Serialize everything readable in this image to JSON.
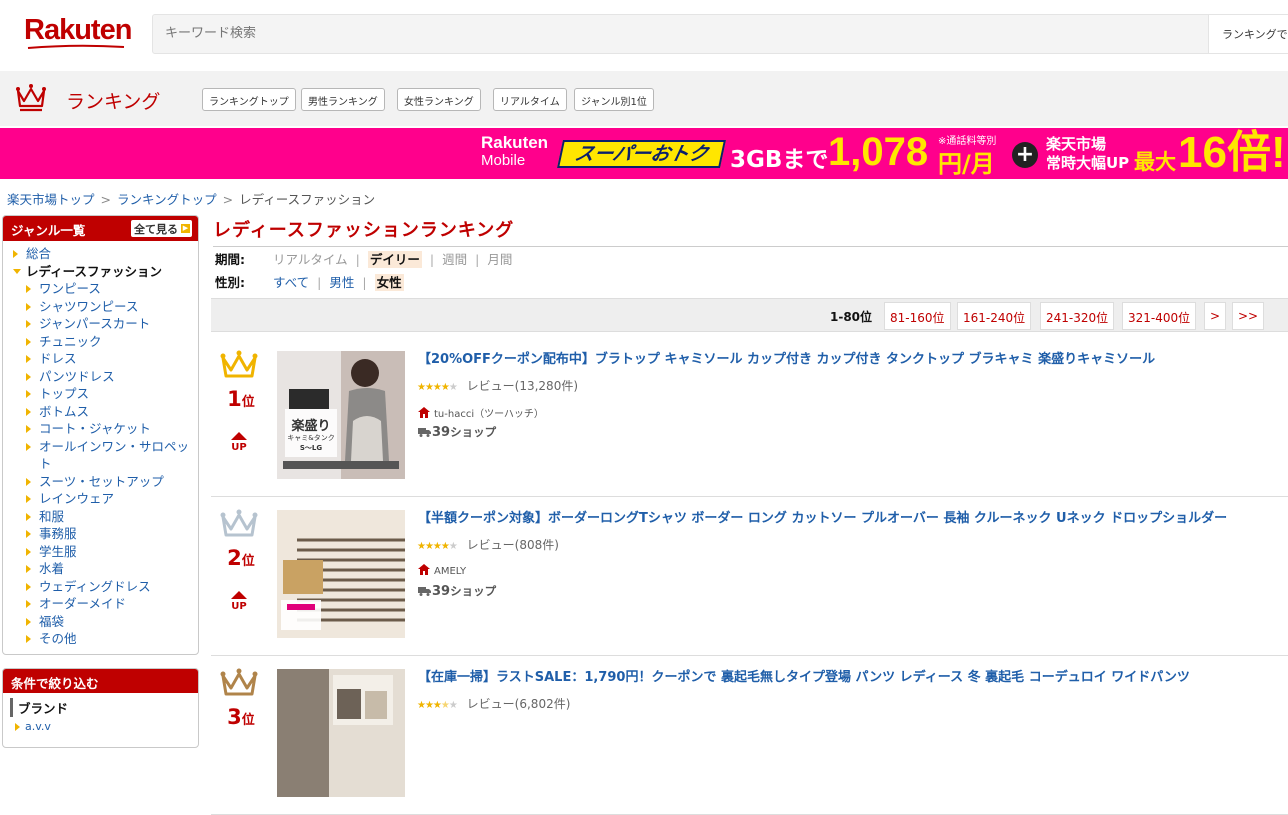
{
  "header": {
    "logo": "Rakuten",
    "search_placeholder": "キーワード検索",
    "search_scope": "ランキングで"
  },
  "ranking_nav": {
    "title": "ランキング",
    "buttons": [
      "ランキングトップ",
      "男性ランキング",
      "女性ランキング",
      "リアルタイム",
      "ジャンル別1位"
    ]
  },
  "banner": {
    "brand_top": "Rakuten",
    "brand_bottom": "Mobile",
    "super": "スーパーおトク",
    "gb": "3GBまで",
    "price": "1,078",
    "note": "※通話料等別",
    "unit": "円/月",
    "plus": "+",
    "market_line1": "楽天市場",
    "market_line2": "常時大幅UP",
    "max": "最大",
    "times": "16倍!"
  },
  "breadcrumb": [
    "楽天市場トップ",
    "ランキングトップ",
    "レディースファッション"
  ],
  "breadcrumb_sep": ">",
  "sidebar": {
    "head": "ジャンル一覧",
    "see_all": "全て見る",
    "items": [
      {
        "label": "総合",
        "level": 0,
        "current": false
      },
      {
        "label": "レディースファッション",
        "level": 0,
        "current": true
      },
      {
        "label": "ワンピース",
        "level": 1,
        "current": false
      },
      {
        "label": "シャツワンピース",
        "level": 1,
        "current": false
      },
      {
        "label": "ジャンパースカート",
        "level": 1,
        "current": false
      },
      {
        "label": "チュニック",
        "level": 1,
        "current": false
      },
      {
        "label": "ドレス",
        "level": 1,
        "current": false
      },
      {
        "label": "パンツドレス",
        "level": 1,
        "current": false
      },
      {
        "label": "トップス",
        "level": 1,
        "current": false
      },
      {
        "label": "ボトムス",
        "level": 1,
        "current": false
      },
      {
        "label": "コート・ジャケット",
        "level": 1,
        "current": false
      },
      {
        "label": "オールインワン・サロペット",
        "level": 1,
        "current": false
      },
      {
        "label": "スーツ・セットアップ",
        "level": 1,
        "current": false
      },
      {
        "label": "レインウェア",
        "level": 1,
        "current": false
      },
      {
        "label": "和服",
        "level": 1,
        "current": false
      },
      {
        "label": "事務服",
        "level": 1,
        "current": false
      },
      {
        "label": "学生服",
        "level": 1,
        "current": false
      },
      {
        "label": "水着",
        "level": 1,
        "current": false
      },
      {
        "label": "ウェディングドレス",
        "level": 1,
        "current": false
      },
      {
        "label": "オーダーメイド",
        "level": 1,
        "current": false
      },
      {
        "label": "福袋",
        "level": 1,
        "current": false
      },
      {
        "label": "その他",
        "level": 1,
        "current": false
      }
    ]
  },
  "filter_box": {
    "head": "条件で絞り込む",
    "brand_label": "ブランド",
    "first_brand": "a.v.v"
  },
  "main": {
    "title": "レディースファッションランキング",
    "period_label": "期間:",
    "period_options": [
      {
        "label": "リアルタイム",
        "state": "disabled"
      },
      {
        "label": "デイリー",
        "state": "selected"
      },
      {
        "label": "週間",
        "state": "disabled"
      },
      {
        "label": "月間",
        "state": "disabled"
      }
    ],
    "gender_label": "性別:",
    "gender_options": [
      {
        "label": "すべて",
        "state": "link"
      },
      {
        "label": "男性",
        "state": "link"
      },
      {
        "label": "女性",
        "state": "selected"
      }
    ]
  },
  "pager": {
    "current": "1-80位",
    "pages": [
      "81-160位",
      "161-240位",
      "241-320位",
      "321-400位",
      ">",
      ">>"
    ]
  },
  "colors": {
    "brand_red": "#bf0000",
    "banner_pink": "#ff008c",
    "banner_yellow": "#ffe600",
    "link_blue": "#1f5ea9",
    "gold": "#f0b400",
    "silver": "#b6c3cf",
    "bronze": "#b0844a"
  },
  "items": [
    {
      "rank": "1",
      "rank_suffix": "位",
      "up": "UP",
      "crown": "gold-crown-icon",
      "title": "【20%OFFクーポン配布中】ブラトップ キャミソール カップ付き カップ付き タンクトップ ブラキャミ 楽盛りキャミソール",
      "rating": 4,
      "reviews": "レビュー(13,280件)",
      "shop": "tu-hacci（ツーハッチ）",
      "ship_num": "39",
      "ship_label": "ショップ",
      "thumb_text1": "楽盛り",
      "thumb_text2": "キャミ&タンク",
      "thumb_text3": "S～LG"
    },
    {
      "rank": "2",
      "rank_suffix": "位",
      "up": "UP",
      "crown": "silver-crown-icon",
      "title": "【半額クーポン対象】ボーダーロングTシャツ ボーダー ロング カットソー プルオーバー 長袖 クルーネック Uネック ドロップショルダー",
      "rating": 4,
      "reviews": "レビュー(808件)",
      "shop": "AMELY",
      "ship_num": "39",
      "ship_label": "ショップ"
    },
    {
      "rank": "3",
      "rank_suffix": "位",
      "up": "",
      "crown": "bronze-crown-icon",
      "title": "【在庫一掃】ラストSALE：1,790円！クーポンで 裏起毛無しタイプ登場 パンツ レディース 冬 裏起毛 コーデュロイ ワイドパンツ",
      "rating": 3.5,
      "reviews": "レビュー(6,802件)",
      "shop": "",
      "ship_num": "",
      "ship_label": ""
    }
  ]
}
